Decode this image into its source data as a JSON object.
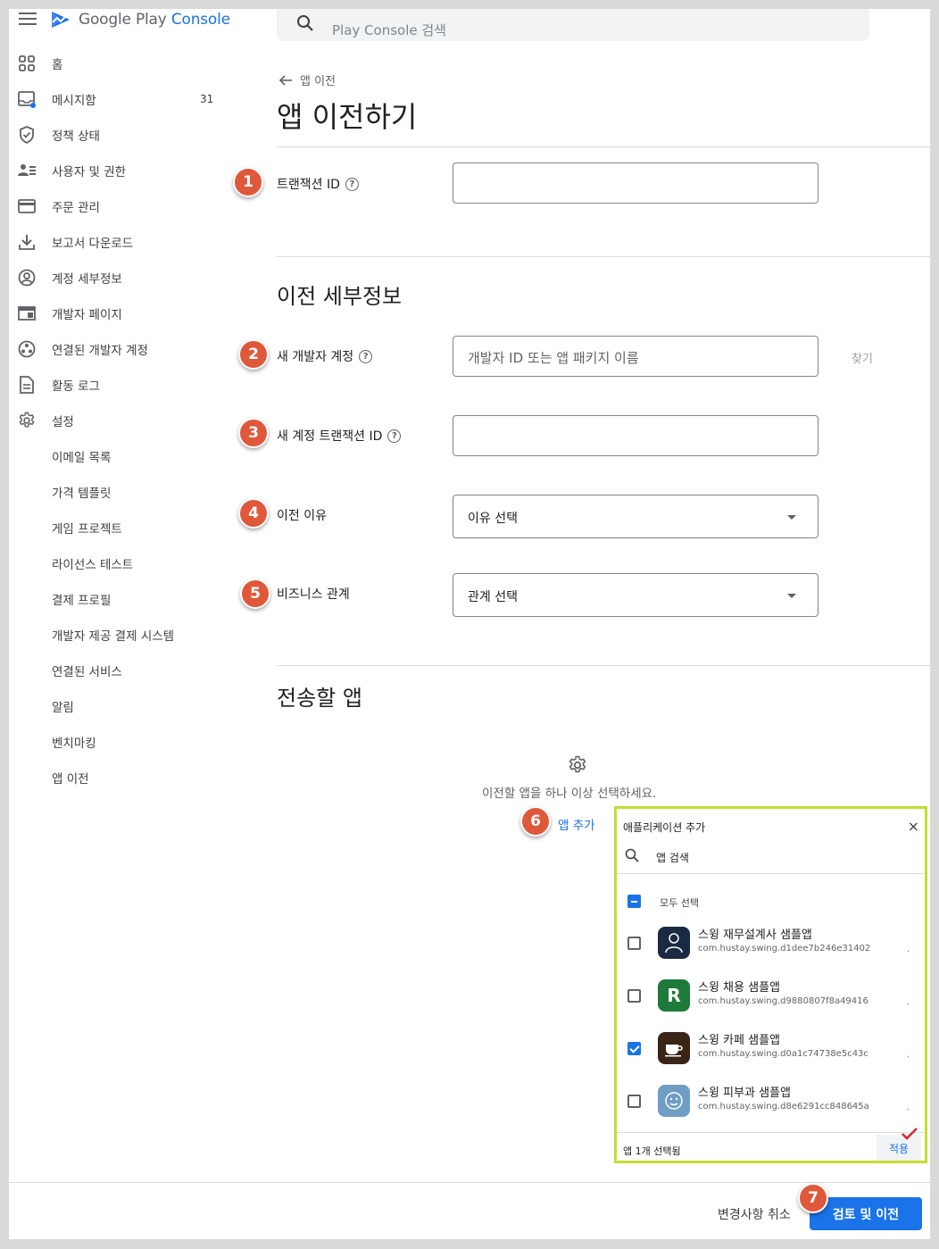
{
  "header": {
    "logo_main": "Google Play",
    "logo_accent": "Console",
    "search_placeholder": "Play Console 검색"
  },
  "sidebar": {
    "items": [
      {
        "label": "홈",
        "icon": "grid-icon"
      },
      {
        "label": "메시지함",
        "icon": "inbox-icon",
        "count": "31"
      },
      {
        "label": "정책 상태",
        "icon": "shield-icon"
      },
      {
        "label": "사용자 및 권한",
        "icon": "users-icon"
      },
      {
        "label": "주문 관리",
        "icon": "card-icon"
      },
      {
        "label": "보고서 다운로드",
        "icon": "download-icon"
      },
      {
        "label": "계정 세부정보",
        "icon": "account-icon"
      },
      {
        "label": "개발자 페이지",
        "icon": "page-icon"
      },
      {
        "label": "연결된 개발자 계정",
        "icon": "link-account-icon"
      },
      {
        "label": "활동 로그",
        "icon": "log-icon"
      },
      {
        "label": "설정",
        "icon": "gear-icon"
      }
    ],
    "sub_items": [
      "이메일 목록",
      "가격 템플릿",
      "게임 프로젝트",
      "라이선스 테스트",
      "결제 프로필",
      "개발자 제공 결제 시스템",
      "연결된 서비스",
      "알림",
      "벤치마킹",
      "앱 이전"
    ]
  },
  "main": {
    "breadcrumb": "앱 이전",
    "title": "앱 이전하기",
    "transaction_label": "트랜잭션 ID",
    "details_title": "이전 세부정보",
    "new_account_label": "새 개발자 계정",
    "new_account_placeholder": "개발자 ID 또는 앱 패키지 이름",
    "find_label": "찾기",
    "new_transaction_label": "새 계정 트랜잭션 ID",
    "reason_label": "이전 이유",
    "reason_value": "이유 선택",
    "relation_label": "비즈니스 관계",
    "relation_value": "관계 선택",
    "apps_title": "전송할 앱",
    "empty_text": "이전할 앱을 하나 이상 선택하세요.",
    "add_app": "앱 추가"
  },
  "badges": [
    "1",
    "2",
    "3",
    "4",
    "5",
    "6",
    "7"
  ],
  "panel": {
    "title": "애플리케이션 추가",
    "close": "×",
    "search_placeholder": "앱 검색",
    "select_all": "모두 선택",
    "apps": [
      {
        "name": "스윙 재무설계사 샘플앱",
        "package": "com.hustay.swing.d1dee7b246e31402",
        "checked": false,
        "icon_color": "#1b2a44"
      },
      {
        "name": "스윙 채용 샘플앱",
        "package": "com.hustay.swing.d9880807f8a49416",
        "checked": false,
        "icon_color": "#1e7a3a"
      },
      {
        "name": "스윙 카페 샘플앱",
        "package": "com.hustay.swing.d0a1c74738e5c43c",
        "checked": true,
        "icon_color": "#3a2418"
      },
      {
        "name": "스윙 피부과 샘플앱",
        "package": "com.hustay.swing.d8e6291cc848645a",
        "checked": false,
        "icon_color": "#6f9dc4"
      }
    ],
    "footer_text": "앱 1개 선택됨",
    "apply": "적용"
  },
  "footer": {
    "cancel": "변경사항 취소",
    "submit": "검토 및 이전"
  },
  "colors": {
    "accent": "#1a73e8",
    "badge": "#e0583a",
    "panel_border": "#c6dd2e"
  }
}
